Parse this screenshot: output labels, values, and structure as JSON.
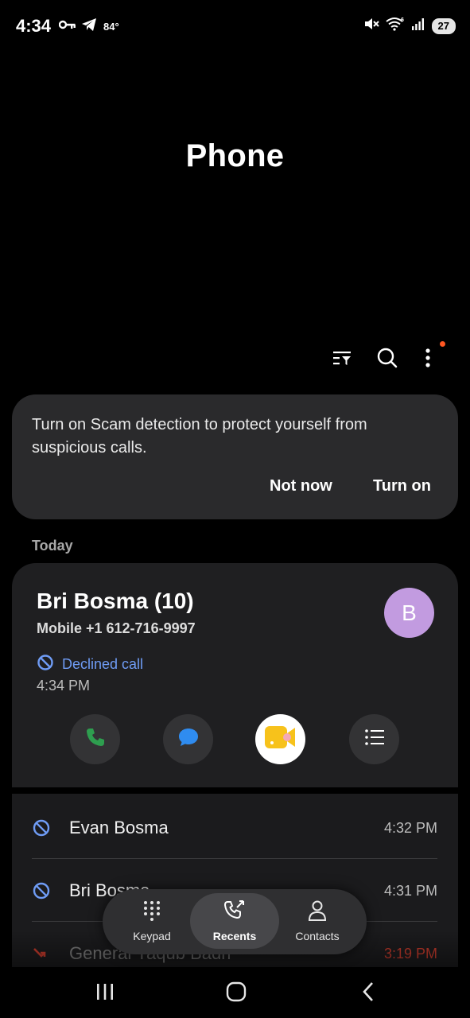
{
  "status_bar": {
    "time": "4:34",
    "temperature": "84°",
    "battery": "27",
    "icons": [
      "key-icon",
      "telegram-icon",
      "mute-icon",
      "wifi-icon",
      "signal-icon"
    ]
  },
  "header": {
    "title": "Phone"
  },
  "toolbar": {
    "icons": [
      "filter-icon",
      "search-icon",
      "more-options-icon"
    ]
  },
  "scam_banner": {
    "message": "Turn on Scam detection to protect yourself from suspicious calls.",
    "dismiss_label": "Not now",
    "confirm_label": "Turn on"
  },
  "section": {
    "today_label": "Today"
  },
  "expanded_call": {
    "name": "Bri Bosma (10)",
    "number": "Mobile +1 612-716-9997",
    "avatar_letter": "B",
    "status": "Declined call",
    "time": "4:34 PM",
    "actions": [
      "call-icon",
      "message-icon",
      "video-call-icon",
      "details-icon"
    ]
  },
  "recents": [
    {
      "name": "Evan Bosma",
      "time": "4:32 PM",
      "type": "declined"
    },
    {
      "name": "Bri Bosma",
      "time": "4:31 PM",
      "type": "declined"
    },
    {
      "name": "General Yaqub Badri",
      "time": "3:19 PM",
      "type": "missed"
    }
  ],
  "bottom_nav": {
    "items": [
      {
        "label": "Keypad",
        "icon": "keypad-icon",
        "active": false
      },
      {
        "label": "Recents",
        "icon": "recents-icon",
        "active": true
      },
      {
        "label": "Contacts",
        "icon": "contacts-icon",
        "active": false
      }
    ]
  },
  "colors": {
    "background": "#000000",
    "card": "#2a2a2c",
    "declined_blue": "#6f9cf5",
    "missed_red": "#c0392b",
    "call_green": "#2e9e4f",
    "message_blue": "#2f8cf0",
    "video_yellow": "#f7c21b",
    "avatar": "#c29be0"
  }
}
